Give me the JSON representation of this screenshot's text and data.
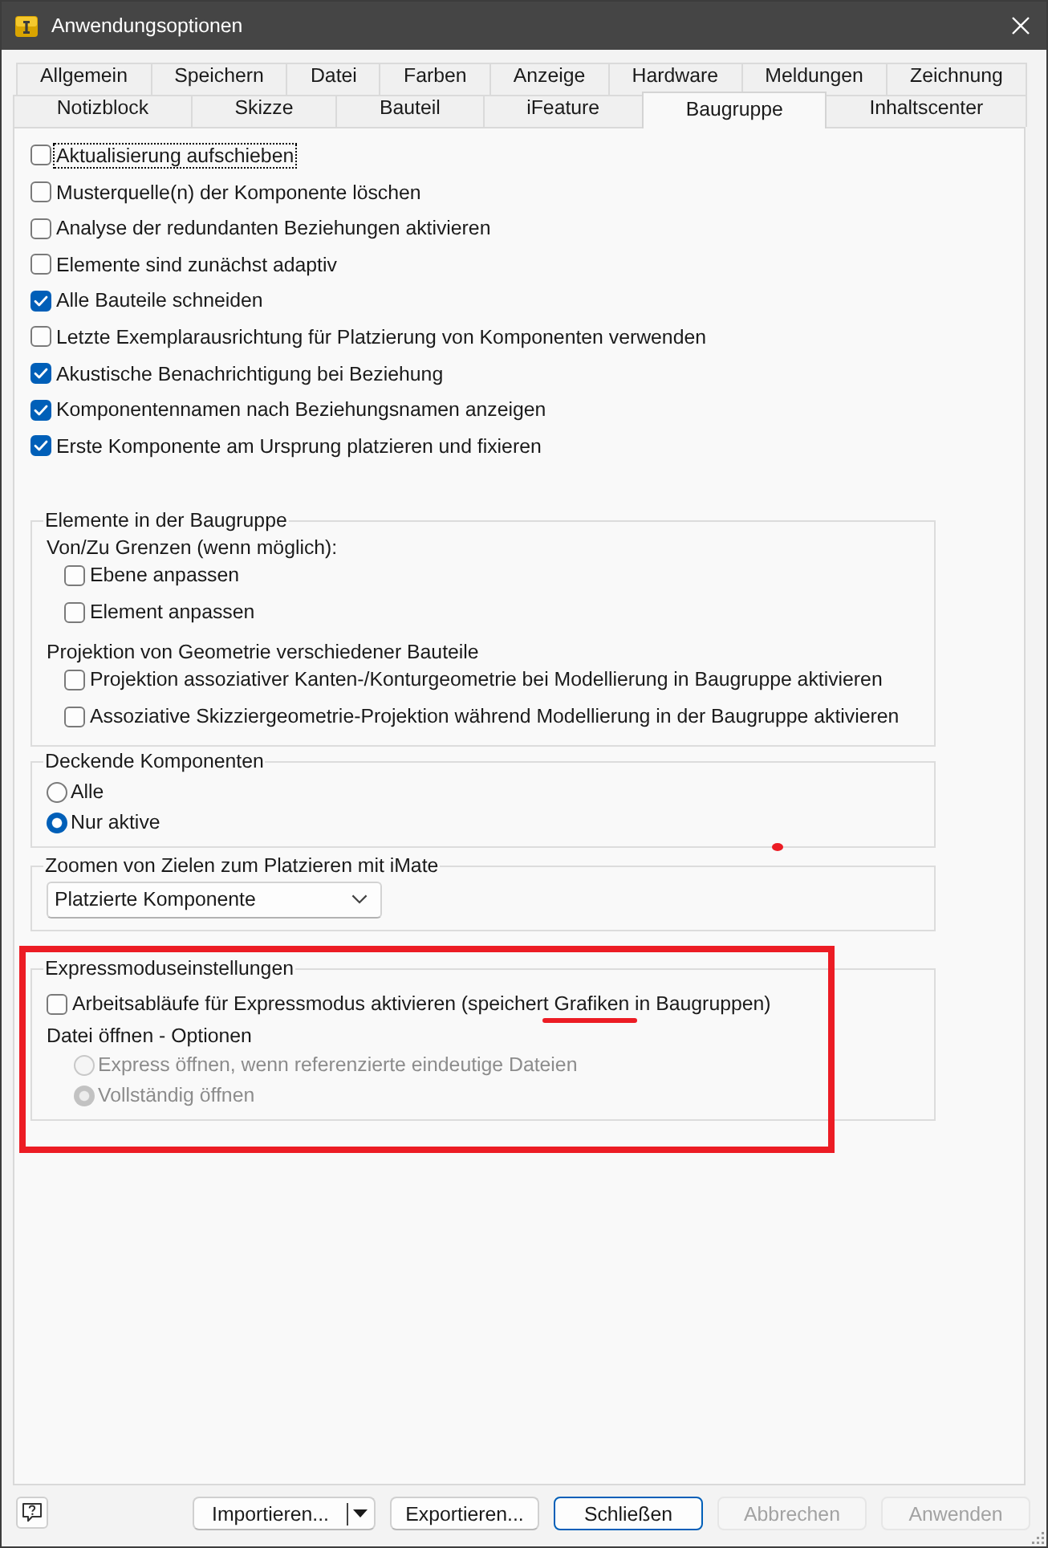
{
  "window": {
    "title": "Anwendungsoptionen"
  },
  "tab_rows": [
    [
      {
        "label": "Allgemein",
        "selected": false
      },
      {
        "label": "Speichern",
        "selected": false
      },
      {
        "label": "Datei",
        "selected": false
      },
      {
        "label": "Farben",
        "selected": false
      },
      {
        "label": "Anzeige",
        "selected": false
      },
      {
        "label": "Hardware",
        "selected": false
      },
      {
        "label": "Meldungen",
        "selected": false
      },
      {
        "label": "Zeichnung",
        "selected": false
      }
    ],
    [
      {
        "label": "Notizblock",
        "selected": false
      },
      {
        "label": "Skizze",
        "selected": false
      },
      {
        "label": "Bauteil",
        "selected": false
      },
      {
        "label": "iFeature",
        "selected": false
      },
      {
        "label": "Baugruppe",
        "selected": true
      },
      {
        "label": "Inhaltscenter",
        "selected": false
      }
    ]
  ],
  "options": [
    {
      "label": "Aktualisierung aufschieben",
      "checked": false,
      "focused": true
    },
    {
      "label": "Musterquelle(n) der Komponente löschen",
      "checked": false,
      "focused": false
    },
    {
      "label": "Analyse der redundanten Beziehungen aktivieren",
      "checked": false,
      "focused": false
    },
    {
      "label": "Elemente sind zunächst adaptiv",
      "checked": false,
      "focused": false
    },
    {
      "label": "Alle Bauteile schneiden",
      "checked": true,
      "focused": false
    },
    {
      "label": "Letzte Exemplarausrichtung für Platzierung von Komponenten verwenden",
      "checked": false,
      "focused": false
    },
    {
      "label": "Akustische Benachrichtigung bei Beziehung",
      "checked": true,
      "focused": false
    },
    {
      "label": "Komponentennamen nach Beziehungsnamen anzeigen",
      "checked": true,
      "focused": false
    },
    {
      "label": "Erste Komponente am Ursprung platzieren und fixieren",
      "checked": true,
      "focused": false
    }
  ],
  "groups": [
    {
      "title": "Elemente in der Baugruppe",
      "items": [
        {
          "kind": "heading",
          "text": "Von/Zu Grenzen (wenn möglich):",
          "children": [
            {
              "kind": "checkbox",
              "label": "Ebene anpassen",
              "checked": false
            },
            {
              "kind": "checkbox",
              "label": "Element anpassen",
              "checked": false
            }
          ]
        },
        {
          "kind": "heading",
          "text": "Projektion von Geometrie verschiedener Bauteile",
          "children": [
            {
              "kind": "checkbox",
              "label": "Projektion assoziativer Kanten-/Konturgeometrie bei Modellierung in Baugruppe aktivieren",
              "checked": false
            },
            {
              "kind": "checkbox",
              "label": "Assoziative Skizziergeometrie-Projektion während Modellierung in der Baugruppe aktivieren",
              "checked": false
            }
          ]
        }
      ]
    },
    {
      "title": "Deckende Komponenten",
      "items": [
        {
          "kind": "radio",
          "label": "Alle",
          "selected": false,
          "disabled": false
        },
        {
          "kind": "radio",
          "label": "Nur aktive",
          "selected": true,
          "disabled": false
        }
      ]
    },
    {
      "title": "Zoomen von Zielen zum Platzieren mit iMate",
      "items": [
        {
          "kind": "dropdown",
          "value": "Platzierte Komponente"
        }
      ]
    },
    {
      "title": "Expressmoduseinstellungen",
      "items": [
        {
          "kind": "checkbox",
          "label": "Arbeitsabläufe für Expressmodus aktivieren (speichert Grafiken in Baugruppen)",
          "checked": false
        },
        {
          "kind": "heading",
          "text": "Datei öffnen - Optionen",
          "children": [
            {
              "kind": "radio",
              "label": "Express öffnen, wenn referenzierte eindeutige Dateien",
              "selected": false,
              "disabled": true
            },
            {
              "kind": "radio",
              "label": "Vollständig öffnen",
              "selected": true,
              "disabled": true
            }
          ]
        }
      ]
    }
  ],
  "buttons": [
    {
      "label": "Importieren...",
      "kind": "split",
      "default": false,
      "disabled": false
    },
    {
      "label": "Exportieren...",
      "kind": "push",
      "default": false,
      "disabled": false
    },
    {
      "label": "Schließen",
      "kind": "push",
      "default": true,
      "disabled": false
    },
    {
      "label": "Abbrechen",
      "kind": "push",
      "default": false,
      "disabled": true
    },
    {
      "label": "Anwenden",
      "kind": "push",
      "default": false,
      "disabled": true
    }
  ],
  "annotations": [
    {
      "kind": "rectangle"
    },
    {
      "kind": "underline"
    },
    {
      "kind": "dot"
    }
  ]
}
